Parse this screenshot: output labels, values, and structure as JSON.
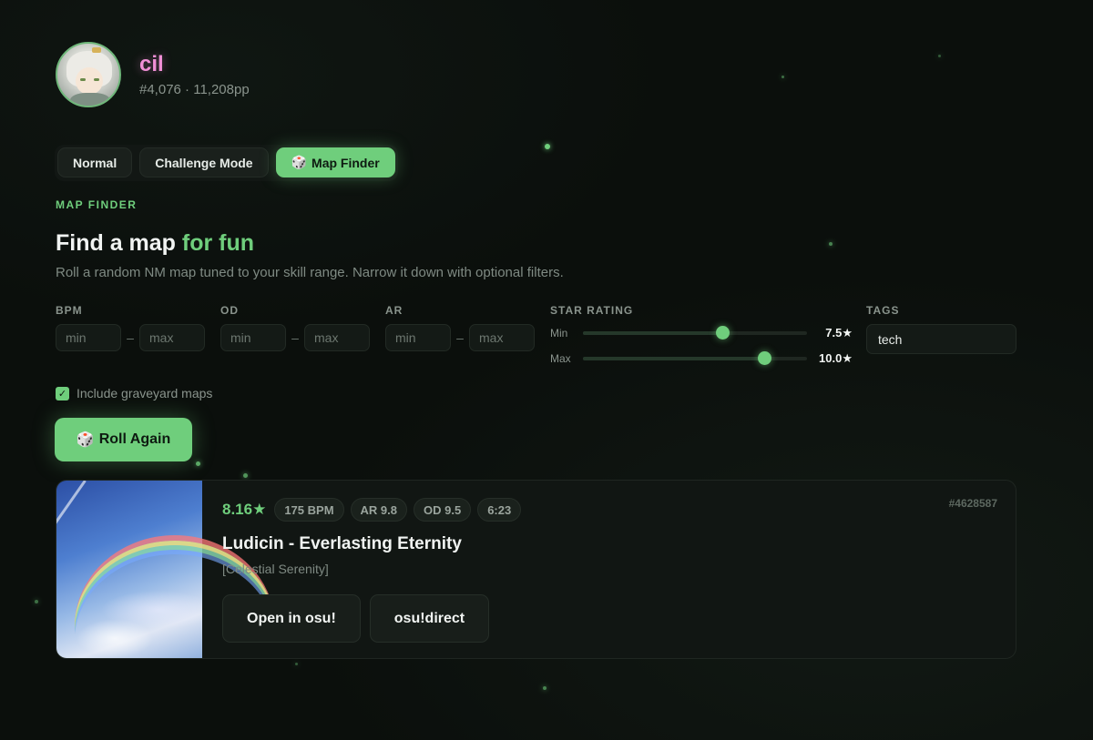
{
  "profile": {
    "username": "cil",
    "rank_pp": "#4,076 · 11,208pp"
  },
  "tabs": [
    {
      "label": "Normal",
      "icon": "",
      "active": false
    },
    {
      "label": "Challenge Mode",
      "icon": "",
      "active": false
    },
    {
      "label": "Map Finder",
      "icon": "🎲",
      "active": true
    }
  ],
  "section_label": "MAP FINDER",
  "headline": {
    "main": "Find a map ",
    "accent": "for fun"
  },
  "subtitle": "Roll a random NM map tuned to your skill range. Narrow it down with optional filters.",
  "filters": {
    "bpm": {
      "label": "BPM",
      "min_placeholder": "min",
      "max_placeholder": "max",
      "separator": "–"
    },
    "od": {
      "label": "OD",
      "min_placeholder": "min",
      "max_placeholder": "max",
      "separator": "–"
    },
    "ar": {
      "label": "AR",
      "min_placeholder": "min",
      "max_placeholder": "max",
      "separator": "–"
    },
    "star_rating": {
      "label": "STAR RATING",
      "min_label": "Min",
      "min_value": "7.5★",
      "min_fraction": 0.62,
      "max_label": "Max",
      "max_value": "10.0★",
      "max_fraction": 0.81
    },
    "tags": {
      "label": "TAGS",
      "value": "tech"
    }
  },
  "graveyard": {
    "label": "Include graveyard maps",
    "checked": true,
    "check_glyph": "✓"
  },
  "roll_button": {
    "icon": "🎲",
    "label": "Roll Again"
  },
  "result": {
    "stars": "8.16★",
    "chips": [
      "175 BPM",
      "AR 9.8",
      "OD 9.5",
      "6:23"
    ],
    "title": "Ludicin - Everlasting Eternity",
    "difficulty": "[Celestial Serenity]",
    "map_id": "#4628587",
    "actions": [
      "Open in osu!",
      "osu!direct"
    ]
  },
  "colors": {
    "accent": "#6fce7c",
    "username": "#f08fd6",
    "background": "#0b0f0c"
  }
}
